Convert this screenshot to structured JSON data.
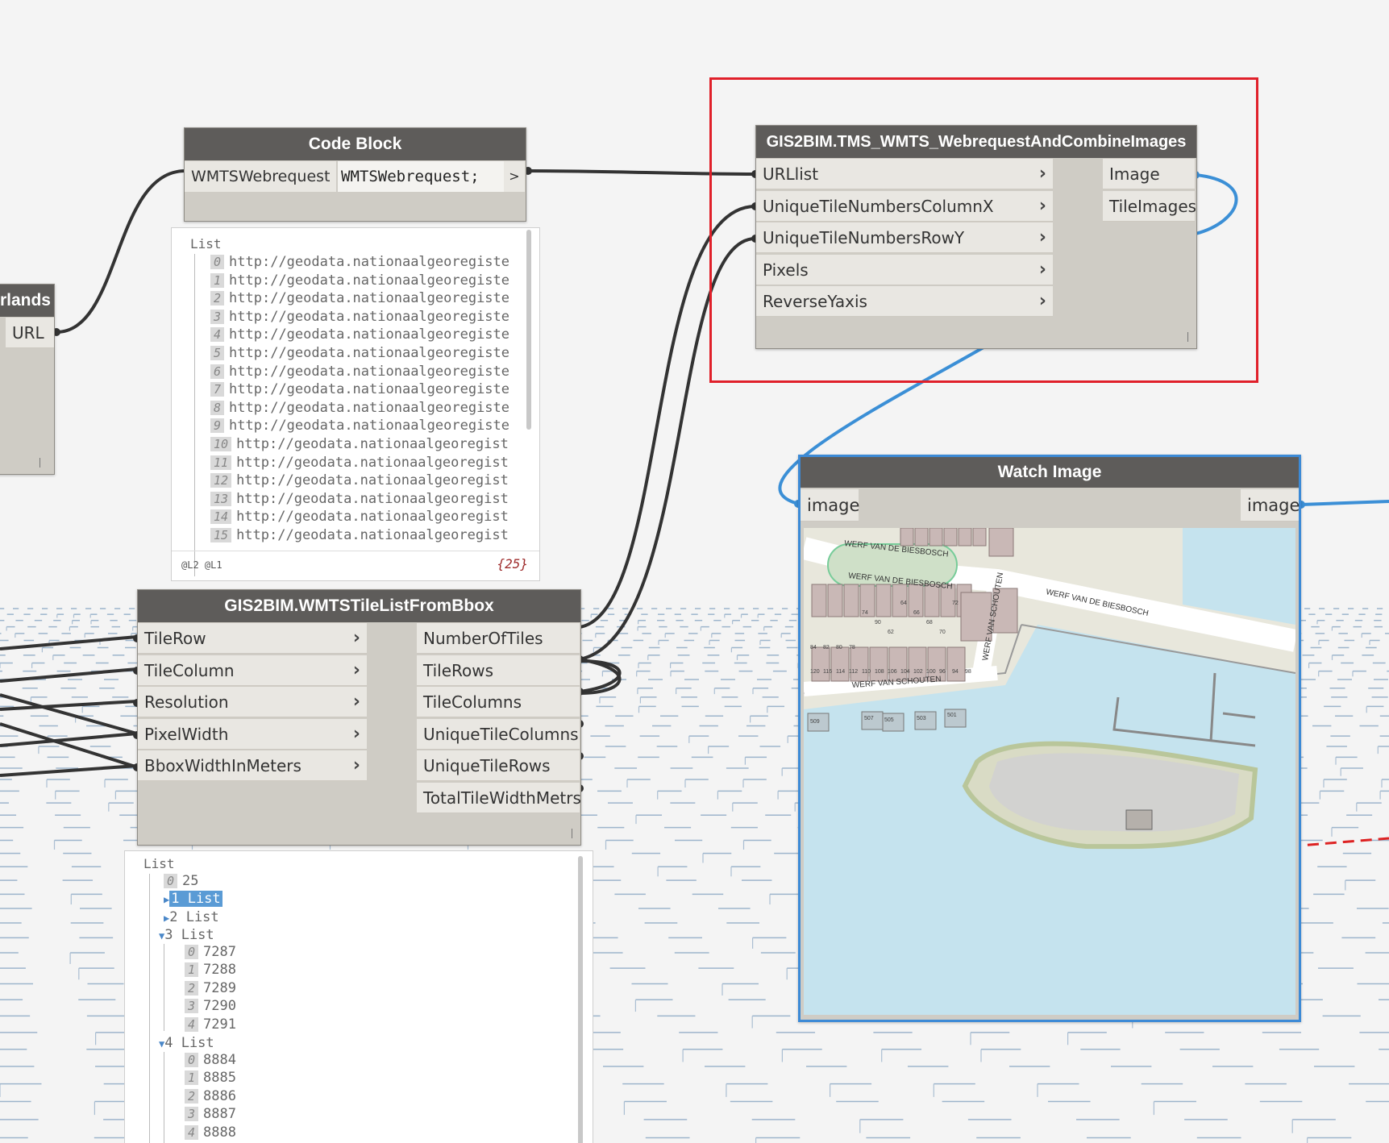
{
  "nodes": {
    "left_partial": {
      "title": "rlands",
      "output": "URL"
    },
    "code_block": {
      "title": "Code Block",
      "input": "WMTSWebrequest",
      "code": "WMTSWebrequest;",
      "output": ">"
    },
    "url_preview": {
      "header": "List",
      "items": [
        {
          "i": "0",
          "v": "http://geodata.nationaalgeoregiste"
        },
        {
          "i": "1",
          "v": "http://geodata.nationaalgeoregiste"
        },
        {
          "i": "2",
          "v": "http://geodata.nationaalgeoregiste"
        },
        {
          "i": "3",
          "v": "http://geodata.nationaalgeoregiste"
        },
        {
          "i": "4",
          "v": "http://geodata.nationaalgeoregiste"
        },
        {
          "i": "5",
          "v": "http://geodata.nationaalgeoregiste"
        },
        {
          "i": "6",
          "v": "http://geodata.nationaalgeoregiste"
        },
        {
          "i": "7",
          "v": "http://geodata.nationaalgeoregiste"
        },
        {
          "i": "8",
          "v": "http://geodata.nationaalgeoregiste"
        },
        {
          "i": "9",
          "v": "http://geodata.nationaalgeoregiste"
        },
        {
          "i": "10",
          "v": "http://geodata.nationaalgeoregist"
        },
        {
          "i": "11",
          "v": "http://geodata.nationaalgeoregist"
        },
        {
          "i": "12",
          "v": "http://geodata.nationaalgeoregist"
        },
        {
          "i": "13",
          "v": "http://geodata.nationaalgeoregist"
        },
        {
          "i": "14",
          "v": "http://geodata.nationaalgeoregist"
        },
        {
          "i": "15",
          "v": "http://geodata.nationaalgeoregist"
        }
      ],
      "levels": "@L2 @L1",
      "count": "{25}"
    },
    "combine": {
      "title": "GIS2BIM.TMS_WMTS_WebrequestAndCombineImages",
      "inputs": [
        "URLlist",
        "UniqueTileNumbersColumnX",
        "UniqueTileNumbersRowY",
        "Pixels",
        "ReverseYaxis"
      ],
      "outputs": [
        "Image",
        "TileImages"
      ]
    },
    "tilelist": {
      "title": "GIS2BIM.WMTSTileListFromBbox",
      "inputs": [
        "TileRow",
        "TileColumn",
        "Resolution",
        "PixelWidth",
        "BboxWidthInMeters"
      ],
      "outputs": [
        "NumberOfTiles",
        "TileRows",
        "TileColumns",
        "UniqueTileColumns",
        "UniqueTileRows",
        "TotalTileWidthMetrs"
      ]
    },
    "watch": {
      "title": "Watch Image",
      "input": "image",
      "output": "image"
    },
    "tile_preview": {
      "header": "List",
      "item0": {
        "i": "0",
        "v": "25"
      },
      "item1": "1 List",
      "item2": "2 List",
      "item3": "3 List",
      "sub3": [
        {
          "i": "0",
          "v": "7287"
        },
        {
          "i": "1",
          "v": "7288"
        },
        {
          "i": "2",
          "v": "7289"
        },
        {
          "i": "3",
          "v": "7290"
        },
        {
          "i": "4",
          "v": "7291"
        }
      ],
      "item4": "4 List",
      "sub4": [
        {
          "i": "0",
          "v": "8884"
        },
        {
          "i": "1",
          "v": "8885"
        },
        {
          "i": "2",
          "v": "8886"
        },
        {
          "i": "3",
          "v": "8887"
        },
        {
          "i": "4",
          "v": "8888"
        }
      ]
    }
  },
  "map": {
    "streets": [
      "WERF VAN DE BIESBOSCH",
      "WERF VAN DE BIESBOSCH",
      "WERF VAN DE BIESBOSCH",
      "WERF VAN SCHOUTEN",
      "WERF VAN SCHOUTEN"
    ],
    "numbers": [
      "509",
      "507",
      "505",
      "503",
      "501",
      "120",
      "116",
      "114",
      "112",
      "110",
      "108",
      "106",
      "104",
      "102",
      "100",
      "96",
      "94",
      "98",
      "84",
      "82",
      "80",
      "78",
      "74",
      "90",
      "62",
      "64",
      "66",
      "68",
      "70",
      "72"
    ]
  },
  "colors": {
    "water": "#c5e3ee",
    "land": "#e8e7dc",
    "highlight_frame": "#e0202a",
    "watch_border": "#3c8ad6",
    "wire_blue": "#3b8fd6",
    "wire_dark": "#333333",
    "node_header": "#5e5c5a"
  }
}
